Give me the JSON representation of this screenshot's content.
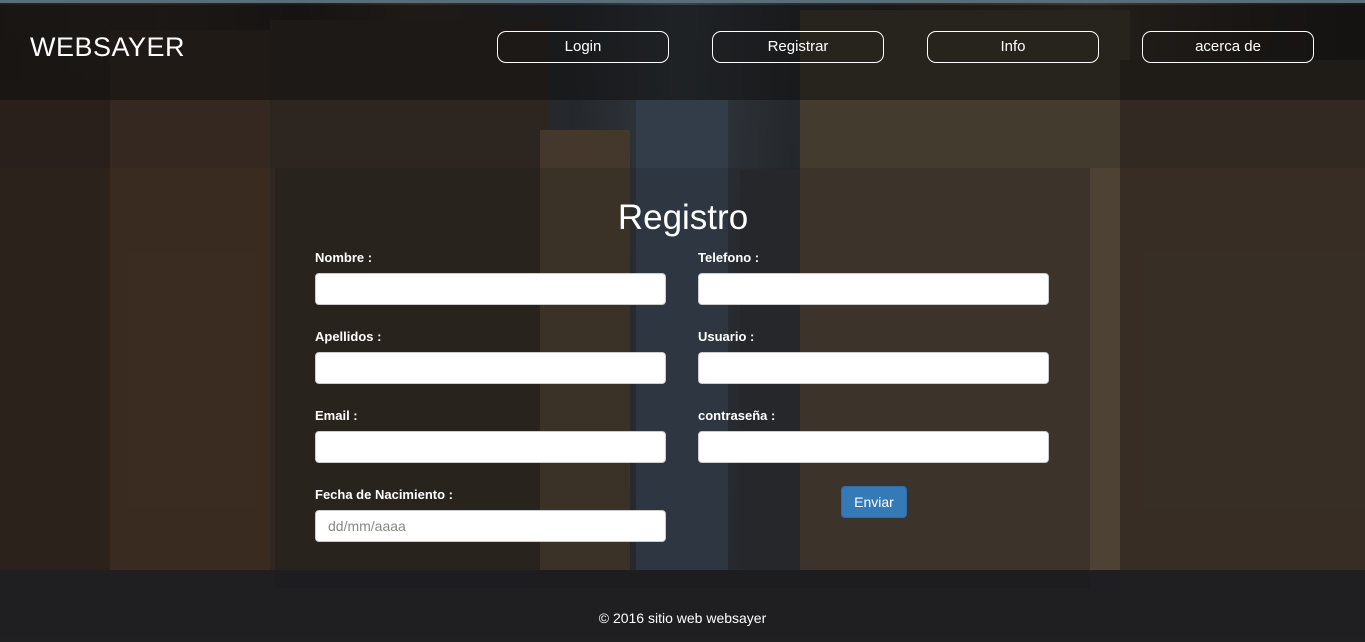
{
  "brand": "WEBSAYER",
  "nav": {
    "login": "Login",
    "registrar": "Registrar",
    "info": "Info",
    "acerca": "acerca de"
  },
  "form": {
    "title": "Registro",
    "nombre_label": "Nombre :",
    "apellidos_label": "Apellidos :",
    "email_label": "Email :",
    "fecha_label": "Fecha de Nacimiento :",
    "fecha_placeholder": "dd/mm/aaaa",
    "telefono_label": "Telefono :",
    "usuario_label": "Usuario :",
    "contrasena_label": "contraseña :",
    "submit_label": "Enviar"
  },
  "footer": "© 2016 sitio web websayer"
}
